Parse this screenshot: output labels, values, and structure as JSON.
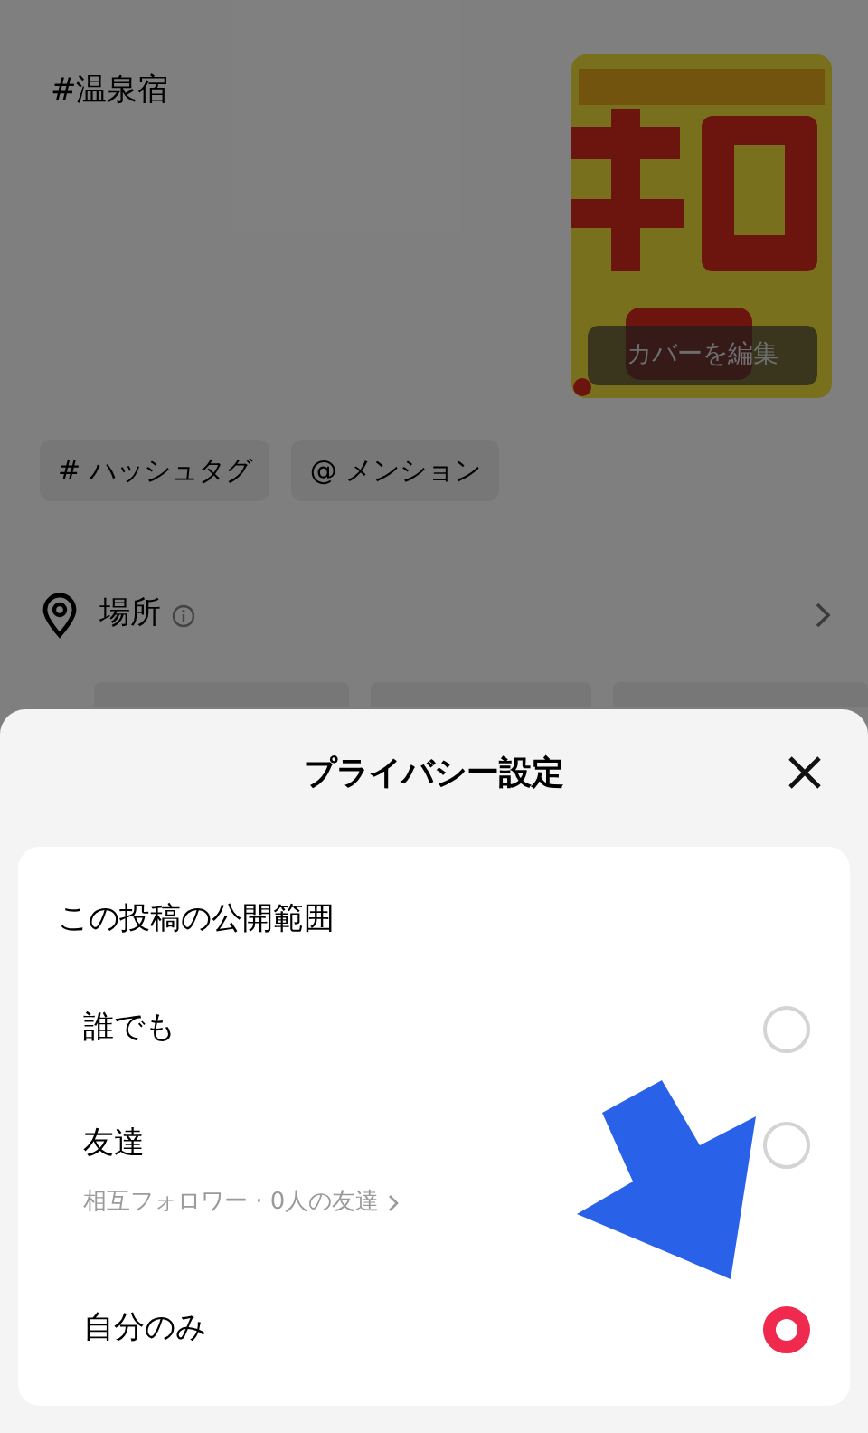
{
  "post": {
    "caption": "#温泉宿",
    "cover": {
      "kind": "picture",
      "edit_button": "カバーを編集"
    },
    "chips": [
      {
        "icon": "#",
        "label": "ハッシュタグ"
      },
      {
        "icon": "@",
        "label": "メンション"
      }
    ],
    "location": {
      "label": "場所"
    }
  },
  "privacy_sheet": {
    "title": "プライバシー設定",
    "section_title": "この投稿の公開範囲",
    "options": [
      {
        "label": "誰でも",
        "selected": false
      },
      {
        "label": "友達",
        "sublabel": "相互フォロワー · 0人の友達",
        "selected": false
      },
      {
        "label": "自分のみ",
        "selected": true
      }
    ]
  }
}
